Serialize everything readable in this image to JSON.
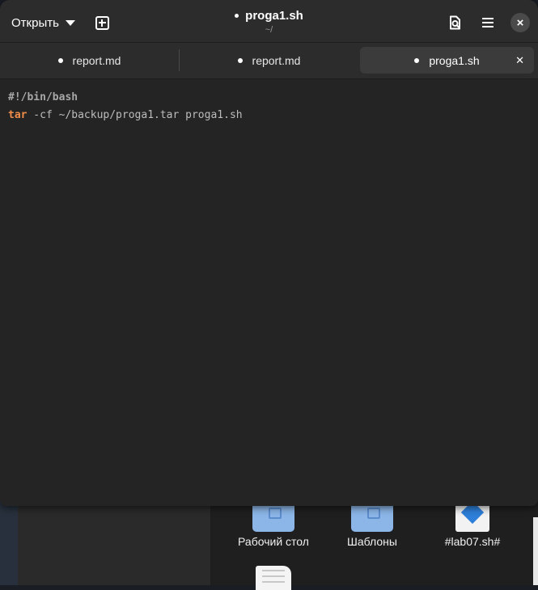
{
  "header": {
    "open_label": "Открыть",
    "title": "proga1.sh",
    "subtitle": "~/"
  },
  "tabs": [
    {
      "label": "report.md",
      "modified": true,
      "active": false
    },
    {
      "label": "report.md",
      "modified": true,
      "active": false
    },
    {
      "label": "proga1.sh",
      "modified": true,
      "active": true
    }
  ],
  "editor": {
    "language": "bash",
    "lines": [
      {
        "text": "#!/bin/bash"
      },
      {
        "keyword": "tar",
        "rest": " -cf ~/backup/proga1.tar proga1.sh"
      }
    ]
  },
  "file_manager": {
    "items": [
      {
        "label": "Рабочий стол",
        "icon": "folder-desktop-icon"
      },
      {
        "label": "Шаблоны",
        "icon": "folder-templates-icon"
      },
      {
        "label": "#lab07.sh#",
        "icon": "script-file-icon"
      }
    ]
  },
  "icons": {
    "open_menu": "chevron-down-icon",
    "new_tab": "new-tab-icon",
    "search": "document-search-icon",
    "menu": "hamburger-menu-icon",
    "close": "close-icon"
  },
  "colors": {
    "keyword": "#f08d49",
    "window_bg": "#242424",
    "headerbar_bg": "#2c2c2c"
  }
}
